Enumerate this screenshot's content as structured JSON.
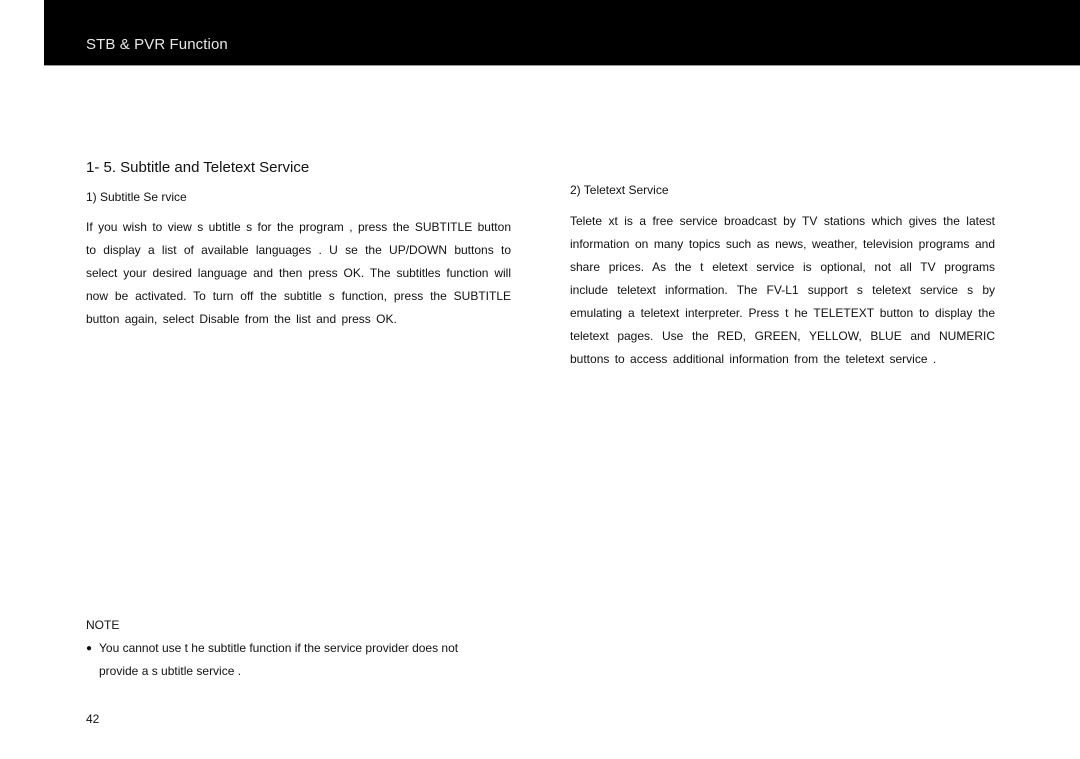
{
  "header": {
    "title": "STB & PVR Function",
    "background_color": "#000000",
    "text_color": "#e8e8e8"
  },
  "section": {
    "title": "1- 5.  Subtitle and Teletext Service"
  },
  "subtitle_service": {
    "heading": "1)  Subtitle Se  rvice",
    "body": "If you wish  to view s ubtitle s for the program , press the SUBTITLE button to display a list of available languages  . U se the UP/DOWN buttons to  select your desired language  and then press OK.  The subtitles function will now be activated.   To turn off  the subtitle s function, press the SUBTITLE  button again, select Disable  from the list and press  OK."
  },
  "teletext_service": {
    "heading": "2)  Teletext Service",
    "body": "Telete xt is a free service broadcast by TV stations which gives   the latest information on many topics such as news, weather, television programs and share prices.  As the t eletext  service  is optional,  not all  TV programs include teletext information.   The FV-L1 support s teletext service s by emulating a teletext interpreter.   Press t he  TELETEXT button to  display the teletext pages.  Use the RED, GREEN, YELLOW, BLUE and NUMERIC  buttons  to access  additional  information from the teletext service  ."
  },
  "note": {
    "label": "NOTE",
    "bullet_icon": "●",
    "items": [
      "You cannot use t  he subtitle  function if the service provider does not provide  a s ubtitle service  ."
    ]
  },
  "page": {
    "number": "42"
  }
}
